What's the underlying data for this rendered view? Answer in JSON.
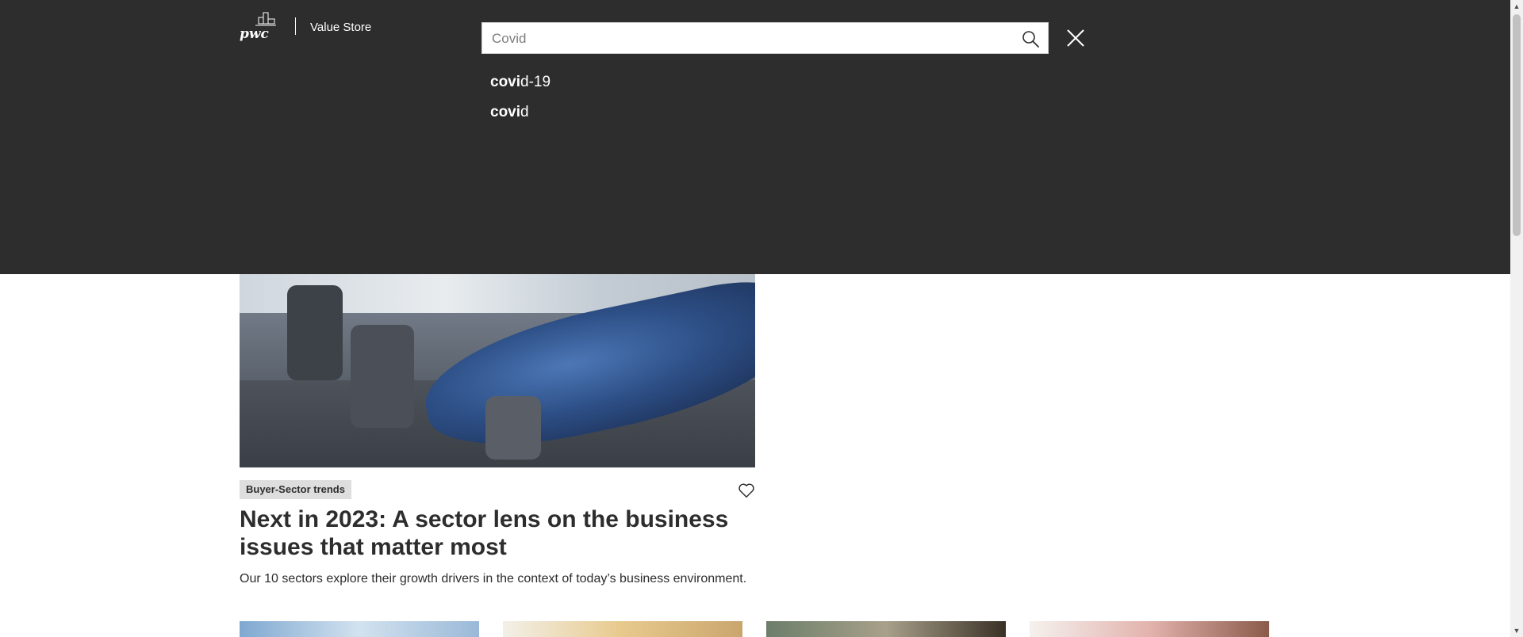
{
  "header": {
    "logo_text": "pwc",
    "brand": "Value Store"
  },
  "search": {
    "value": "Covid",
    "placeholder": "",
    "suggestions": [
      {
        "match": "covi",
        "rest": "d-19"
      },
      {
        "match": "covi",
        "rest": "d"
      }
    ]
  },
  "article": {
    "tag": "Buyer-Sector trends",
    "title": "Next in 2023: A sector lens on the business issues that matter most",
    "summary": "Our 10 sectors explore their growth drivers in the context of today’s business environment."
  },
  "colors": {
    "overlay_bg": "#2d2d2d",
    "text_dark": "#2d2d2d",
    "tag_bg": "#dedede",
    "white": "#ffffff"
  },
  "icons": [
    "pwc-logo-icon",
    "search-icon",
    "close-icon",
    "heart-icon"
  ]
}
